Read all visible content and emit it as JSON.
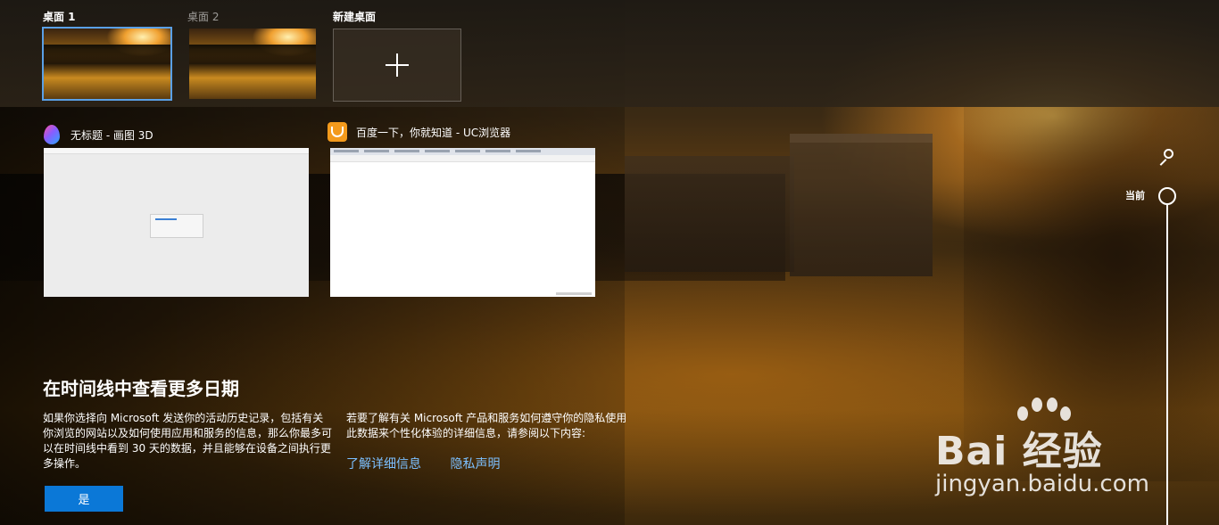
{
  "desktops": [
    {
      "label": "桌面 1",
      "active": true
    },
    {
      "label": "桌面 2",
      "active": false
    }
  ],
  "new_desktop": {
    "label": "新建桌面"
  },
  "windows": [
    {
      "title": "无标题 - 画图 3D",
      "icon": "paint-3d-icon"
    },
    {
      "title": "百度一下，你就知道 - UC浏览器",
      "icon": "uc-browser-icon"
    }
  ],
  "timeline": {
    "current_label": "当前"
  },
  "promo": {
    "title": "在时间线中查看更多日期",
    "left_text": "如果你选择向 Microsoft 发送你的活动历史记录，包括有关你浏览的网站以及如何使用应用和服务的信息，那么你最多可以在时间线中看到 30 天的数据，并且能够在设备之间执行更多操作。",
    "right_text": "若要了解有关 Microsoft 产品和服务如何遵守你的隐私使用此数据来个性化体验的详细信息，请参阅以下内容:",
    "link_details": "了解详细信息",
    "link_privacy": "隐私声明",
    "yes_button": "是"
  },
  "watermark": {
    "main": "Bai  经验",
    "sub": "jingyan.baidu.com"
  },
  "colors": {
    "accent": "#0b78d7",
    "link": "#7cc0ff",
    "active_outline": "#5aa0e6"
  }
}
